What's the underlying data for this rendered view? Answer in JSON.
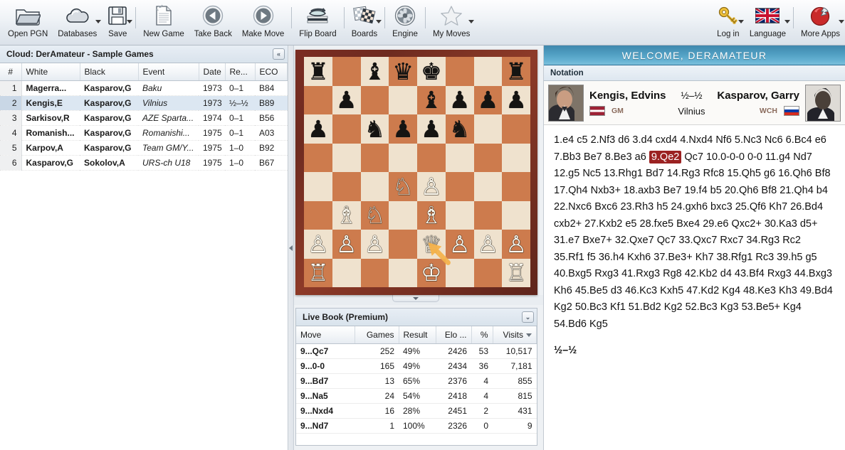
{
  "toolbar": {
    "items": [
      {
        "label": "Open PGN",
        "icon": "folder-icon",
        "caret": false
      },
      {
        "label": "Databases",
        "icon": "cloud-icon",
        "caret": true
      },
      {
        "label": "Save",
        "icon": "floppy-disk-icon",
        "caret": true
      },
      {
        "label": "New Game",
        "icon": "document-icon",
        "caret": false
      },
      {
        "label": "Take Back",
        "icon": "arrow-left-circle-icon",
        "caret": false
      },
      {
        "label": "Make Move",
        "icon": "arrow-right-circle-icon",
        "caret": false
      },
      {
        "label": "Flip Board",
        "icon": "flip-board-icon",
        "caret": false
      },
      {
        "label": "Boards",
        "icon": "boards-icon",
        "caret": true
      },
      {
        "label": "Engine",
        "icon": "engine-fan-icon",
        "caret": false
      },
      {
        "label": "My Moves",
        "icon": "star-icon",
        "caret": true
      }
    ],
    "right_items": [
      {
        "label": "Log in",
        "icon": "key-icon",
        "caret": true
      },
      {
        "label": "Language",
        "icon": "uk-flag-icon",
        "caret": true
      },
      {
        "label": "More Apps",
        "icon": "more-apps-icon",
        "caret": true
      }
    ]
  },
  "games_panel": {
    "title": "Cloud: DerAmateur - Sample Games",
    "collapse_label": "«",
    "columns": [
      "#",
      "White",
      "Black",
      "Event",
      "Date",
      "Re...",
      "ECO"
    ],
    "rows": [
      {
        "n": "1",
        "white": "Magerra...",
        "black": "Kasparov,G",
        "event": "Baku",
        "date": "1973",
        "result": "0–1",
        "eco": "B84",
        "selected": false
      },
      {
        "n": "2",
        "white": "Kengis,E",
        "black": "Kasparov,G",
        "event": "Vilnius",
        "date": "1973",
        "result": "½–½",
        "eco": "B89",
        "selected": true
      },
      {
        "n": "3",
        "white": "Sarkisov,R",
        "black": "Kasparov,G",
        "event": "AZE Sparta...",
        "date": "1974",
        "result": "0–1",
        "eco": "B56",
        "selected": false
      },
      {
        "n": "4",
        "white": "Romanish...",
        "black": "Kasparov,G",
        "event": "Romanishi...",
        "date": "1975",
        "result": "0–1",
        "eco": "A03",
        "selected": false
      },
      {
        "n": "5",
        "white": "Karpov,A",
        "black": "Kasparov,G",
        "event": "Team GM/Y...",
        "date": "1975",
        "result": "1–0",
        "eco": "B92",
        "selected": false
      },
      {
        "n": "6",
        "white": "Kasparov,G",
        "black": "Sokolov,A",
        "event": "URS-ch U18",
        "date": "1975",
        "result": "1–0",
        "eco": "B67",
        "selected": false
      }
    ]
  },
  "board": {
    "light_color": "#efe2ce",
    "dark_color": "#cd7b4d",
    "frame_color": "#7b2c22",
    "arrow_color": "#f5b24a",
    "arrow_from": "f1",
    "arrow_to": "e2",
    "ranks": [
      [
        "r",
        "",
        "b",
        "q",
        "k",
        "",
        "",
        "r"
      ],
      [
        "",
        "p",
        "",
        "",
        "b",
        "p",
        "p",
        "p"
      ],
      [
        "p",
        "",
        "n",
        "p",
        "p",
        "n",
        "",
        ""
      ],
      [
        "",
        "",
        "",
        "",
        "",
        "",
        "",
        ""
      ],
      [
        "",
        "",
        "",
        "N",
        "P",
        "",
        "",
        ""
      ],
      [
        "",
        "B",
        "N",
        "",
        "B",
        "",
        "",
        ""
      ],
      [
        "P",
        "P",
        "P",
        "",
        "Q",
        "P",
        "P",
        "P"
      ],
      [
        "R",
        "",
        "",
        "",
        "K",
        "",
        "",
        "R"
      ]
    ]
  },
  "livebook": {
    "title": "Live Book (Premium)",
    "collapse_label": "⌄",
    "columns": [
      "Move",
      "Games",
      "Result",
      "Elo ...",
      "%",
      "Visits"
    ],
    "sorted_by": "Visits",
    "rows": [
      {
        "move": "9...Qc7",
        "games": "252",
        "result": "49%",
        "elo": "2426",
        "pct": "53",
        "visits": "10,517"
      },
      {
        "move": "9...0-0",
        "games": "165",
        "result": "49%",
        "elo": "2434",
        "pct": "36",
        "visits": "7,181"
      },
      {
        "move": "9...Bd7",
        "games": "13",
        "result": "65%",
        "elo": "2376",
        "pct": "4",
        "visits": "855"
      },
      {
        "move": "9...Na5",
        "games": "24",
        "result": "54%",
        "elo": "2418",
        "pct": "4",
        "visits": "815"
      },
      {
        "move": "9...Nxd4",
        "games": "16",
        "result": "28%",
        "elo": "2451",
        "pct": "2",
        "visits": "431"
      },
      {
        "move": "9...Nd7",
        "games": "1",
        "result": "100%",
        "elo": "2326",
        "pct": "0",
        "visits": "9"
      }
    ]
  },
  "right_panel": {
    "welcome": "WELCOME, DERAMATEUR",
    "notation_tab": "Notation",
    "white_player": {
      "name": "Kengis, Edvins",
      "title": "GM",
      "country": "Latvia"
    },
    "black_player": {
      "name": "Kasparov, Garry",
      "title": "WCH",
      "country": "Russia"
    },
    "score": "½–½",
    "site": "Vilnius",
    "moves_before": "1.e4 c5 2.Nf3 d6 3.d4 cxd4 4.Nxd4 Nf6 5.Nc3 Nc6 6.Bc4 e6 7.Bb3 Be7 8.Be3 a6 ",
    "highlighted_move": "9.Qe2",
    "moves_after": " Qc7 10.0-0-0 0-0 11.g4 Nd7 12.g5 Nc5 13.Rhg1 Bd7 14.Rg3 Rfc8 15.Qh5 g6 16.Qh6 Bf8 17.Qh4 Nxb3+ 18.axb3 Be7 19.f4 b5 20.Qh6 Bf8 21.Qh4 b4 22.Nxc6 Bxc6 23.Rh3 h5 24.gxh6 bxc3 25.Qf6 Kh7 26.Bd4 cxb2+ 27.Kxb2 e5 28.fxe5 Bxe4 29.e6 Qxc2+ 30.Ka3 d5+ 31.e7 Bxe7+ 32.Qxe7 Qc7 33.Qxc7 Rxc7 34.Rg3 Rc2 35.Rf1 f5 36.h4 Kxh6 37.Be3+ Kh7 38.Rfg1 Rc3 39.h5 g5 40.Bxg5 Rxg3 41.Rxg3 Rg8 42.Kb2 d4 43.Bf4 Rxg3 44.Bxg3 Kh6 45.Be5 d3 46.Kc3 Kxh5 47.Kd2 Kg4 48.Ke3 Kh3 49.Bd4 Kg2 50.Bc3 Kf1 51.Bd2 Kg2 52.Bc3 Kg3 53.Be5+ Kg4 54.Bd6 Kg5",
    "result": "½–½"
  }
}
